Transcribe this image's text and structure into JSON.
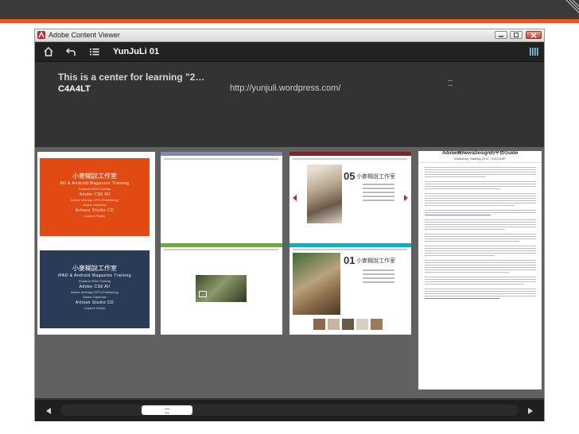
{
  "window": {
    "title": "Adobe Content Viewer",
    "controls": [
      "minimize",
      "maximize",
      "close"
    ]
  },
  "toolbar": {
    "home_icon": "home-icon",
    "back_icon": "back-arrow-icon",
    "list_icon": "list-icon",
    "title": "YunJuLi 01",
    "browse_icon": "browse-mode-icon"
  },
  "header": {
    "title": "This is a center for learning \"2…",
    "code": "C4A4LT",
    "url": "http://yunjuli.wordpress.com/"
  },
  "pages": {
    "cover1": {
      "cn": "小麥糊說工作室",
      "en1": "AD & Android Magazine Training",
      "en2": "Eduardo 0000 Training",
      "en3": "Adobe CS6 All",
      "en4": "Adobe InDesign DPS (Publishing)",
      "en5": "Adobe Captivate",
      "en6": "Artisan Studio CD",
      "en7": "Capture Studio",
      "bg": "#e14a12"
    },
    "cover2": {
      "cn": "小麥糊說工作室",
      "en1": "iPAD & Android Magazine Training",
      "en2": "Eduardo 0000 Training",
      "en3": "Adobe CS6 All",
      "en4": "Adobe InDesign DPS (Publishing)",
      "en5": "Adobe Captivate",
      "en6": "Artisan Studio CD",
      "en7": "Capture Studio",
      "bg": "#2a3b57"
    },
    "feature_top": {
      "number": "05",
      "cn": "小麥糊說工作室",
      "strip": "#8b1a2a"
    },
    "feature_bottom": {
      "number": "01",
      "cn": "小麥糊說工作室",
      "strip": "#1aa9b5"
    },
    "article": {
      "title": "Adobe與NewsDesign的平台Guide",
      "subtitle": "Workshop Training 2012 - 2013 ASP"
    }
  },
  "scroll": {
    "position_fraction": 0.2
  }
}
